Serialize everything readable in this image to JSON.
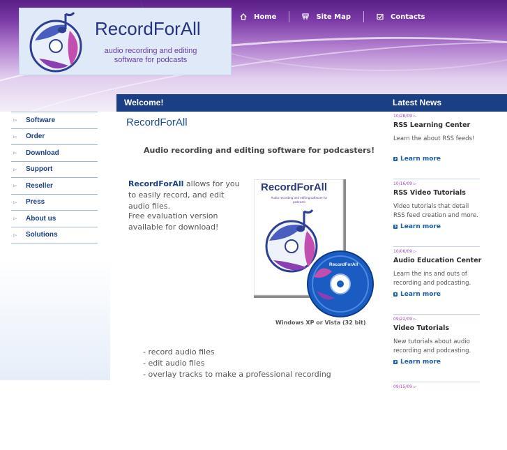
{
  "brand": {
    "title": "RecordForAll",
    "tagline": "audio recording and editing software for podcasts"
  },
  "topnav": [
    {
      "label": "Home",
      "icon": "home-icon"
    },
    {
      "label": "Site Map",
      "icon": "sitemap-icon"
    },
    {
      "label": "Contacts",
      "icon": "mail-icon"
    }
  ],
  "bars": {
    "welcome": "Welcome!",
    "news": "Latest News"
  },
  "sidebar": {
    "items": [
      {
        "label": "Software"
      },
      {
        "label": "Order"
      },
      {
        "label": "Download"
      },
      {
        "label": "Support"
      },
      {
        "label": "Reseller"
      },
      {
        "label": "Press"
      },
      {
        "label": "About us"
      },
      {
        "label": "Solutions"
      }
    ]
  },
  "main": {
    "title": "RecordForAll",
    "subtitle": "Audio recording and editing software for podcasters!",
    "intro_brand": "RecordForAll",
    "intro_rest": " allows for you to easily record, and edit audio files.",
    "free": "Free evaluation version available for download!",
    "product_box_title": "RecordForAll",
    "product_box_tagline": "Audio recording and editing software for podcasts",
    "product_cd_title": "RecordForAll",
    "os_caption": "Windows XP or Vista (32 bit)",
    "features": [
      "- record audio files",
      "- edit audio files",
      "- overlay tracks to make a professional recording"
    ]
  },
  "news": {
    "learn_more": "Learn more",
    "items": [
      {
        "date": "10/28/09",
        "title": "RSS Learning Center",
        "body": "Learn the about RSS feeds!"
      },
      {
        "date": "10/16/09",
        "title": "RSS Video Tutorials",
        "body": "Video tutorials that detail RSS feed creation and more."
      },
      {
        "date": "10/06/09",
        "title": "Audio Education Center",
        "body": "Learn the ins and outs of recording and podcasting."
      },
      {
        "date": "09/22/09",
        "title": "Video Tutorials",
        "body": "New tutorials about audio recording and podcasting."
      },
      {
        "date": "09/15/09",
        "title": "",
        "body": ""
      }
    ]
  },
  "colors": {
    "header_purple": "#7a3aa6",
    "bar_blue": "#1b3f84",
    "link_blue": "#1c5fa8",
    "date_purple": "#9c4bb5"
  }
}
